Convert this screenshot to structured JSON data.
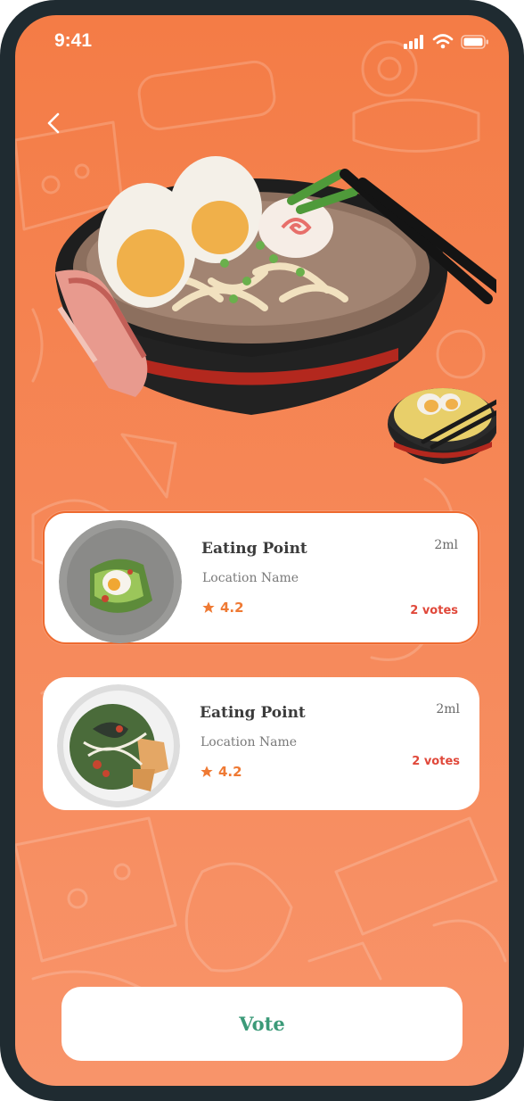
{
  "status_bar": {
    "time": "9:41",
    "icons": [
      "cellular-signal-icon",
      "wifi-icon",
      "battery-icon"
    ]
  },
  "header": {
    "back_icon": "chevron-left-icon"
  },
  "hero": {
    "image": "ramen-bowl-illustration",
    "secondary_image": "small-ramen-bowl-illustration"
  },
  "places": [
    {
      "name": "Eating Point",
      "location": "Location Name",
      "rating": "4.2",
      "distance": "2ml",
      "votes": "2 votes",
      "selected": true,
      "image": "avocado-toast-egg-dish"
    },
    {
      "name": "Eating Point",
      "location": "Location Name",
      "rating": "4.2",
      "distance": "2ml",
      "votes": "2 votes",
      "selected": false,
      "image": "salad-with-chicken-dish"
    }
  ],
  "actions": {
    "vote_label": "Vote"
  },
  "colors": {
    "background": "#f47c46",
    "accent": "#ef7a34",
    "votes": "#e0483a",
    "vote_button_text": "#3b9a78",
    "frame": "#1f2b31"
  }
}
